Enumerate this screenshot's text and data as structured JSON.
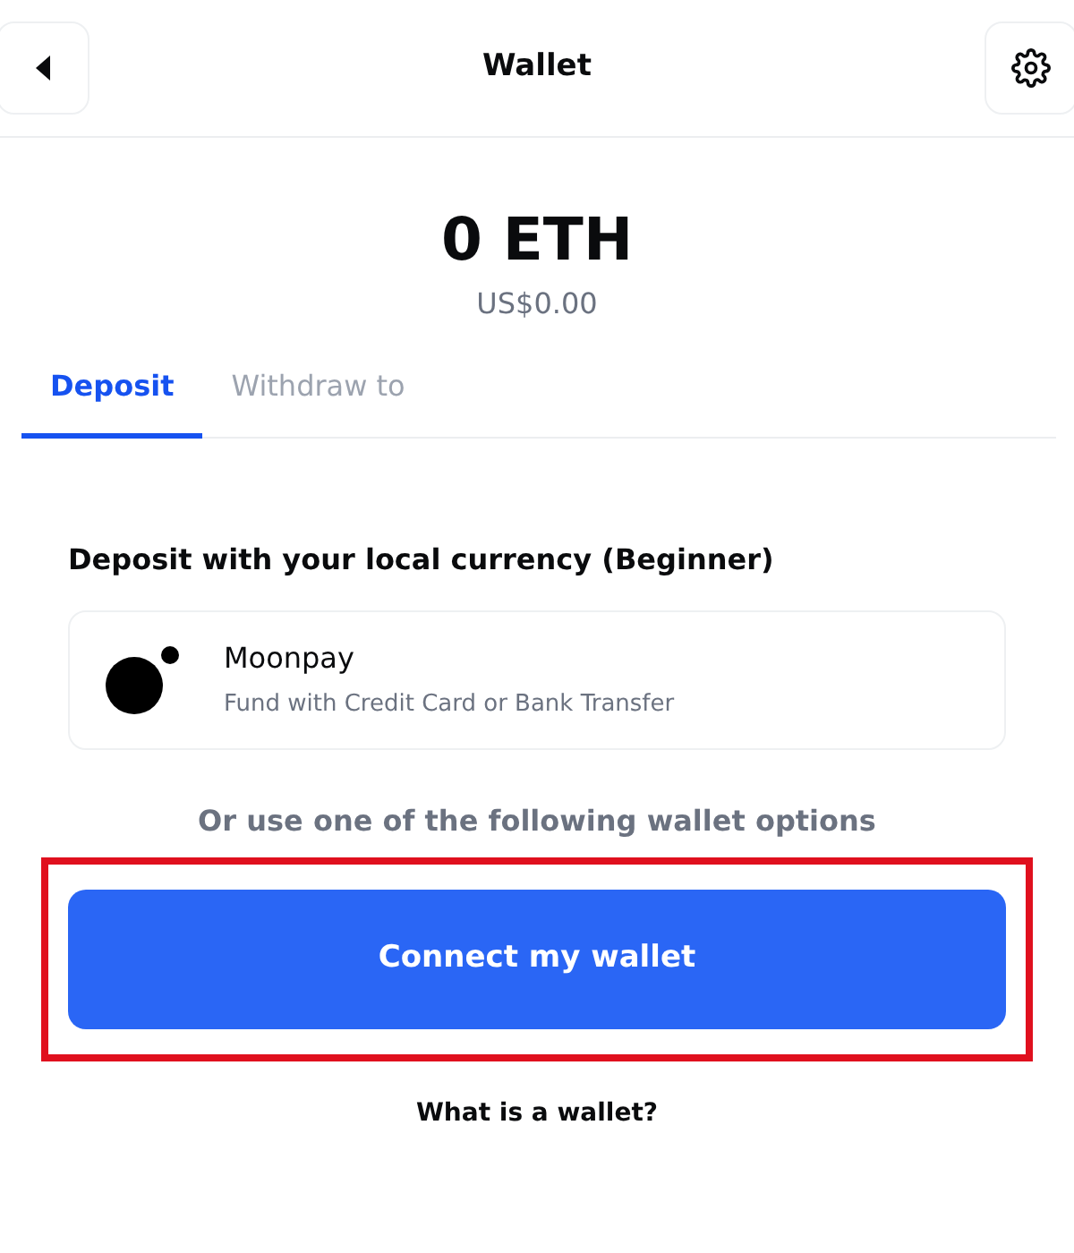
{
  "header": {
    "title": "Wallet"
  },
  "balance": {
    "amount": "0 ETH",
    "fiat": "US$0.00"
  },
  "tabs": [
    {
      "label": "Deposit",
      "selected": true
    },
    {
      "label": "Withdraw to",
      "selected": false
    }
  ],
  "deposit": {
    "heading": "Deposit with your local currency (Beginner)",
    "providers": [
      {
        "name": "Moonpay",
        "description": "Fund with Credit Card or Bank Transfer"
      }
    ],
    "divider_text": "Or use one of the following wallet options",
    "connect_button": {
      "label": "Connect my wallet",
      "highlighted": true
    },
    "help_link": "What is a wallet?"
  }
}
